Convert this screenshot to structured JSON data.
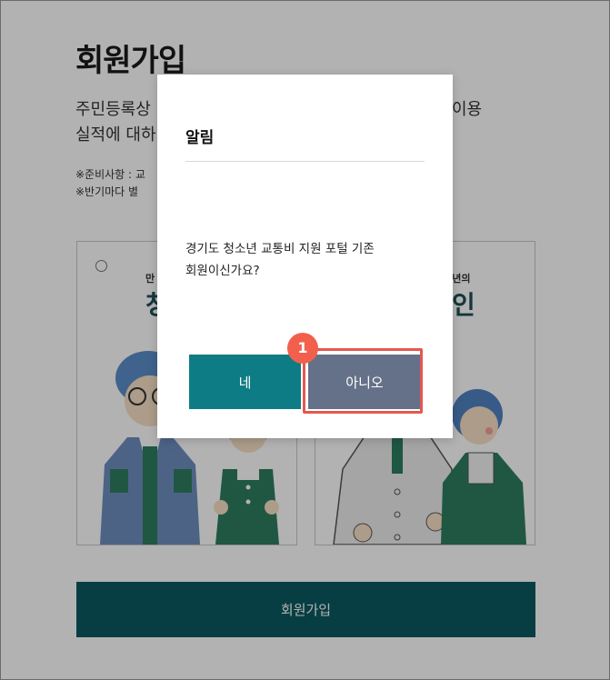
{
  "page": {
    "title": "회원가입",
    "description_line1": "주민등록상",
    "description_line1_tail": "이용",
    "description_line2": "실적에 대하",
    "prep_line1": "※준비사항 : 교",
    "prep_line2": "※반기마다 별",
    "submit_label": "회원가입"
  },
  "cards": {
    "left": {
      "sub_label": "만",
      "main_label": "청"
    },
    "right": {
      "sub_label": "청소년의",
      "main_label": "인"
    }
  },
  "modal": {
    "title": "알림",
    "message_line1": "경기도 청소년 교통비 지원 포털 기존",
    "message_line2": "회원이신가요?",
    "yes_label": "네",
    "no_label": "아니오"
  },
  "annotation": {
    "step_number": "1"
  },
  "colors": {
    "submit": "#0b5a61",
    "yes_button": "#0e7c84",
    "no_button": "#657188",
    "highlight": "#e4584f",
    "badge": "#f2604d"
  }
}
